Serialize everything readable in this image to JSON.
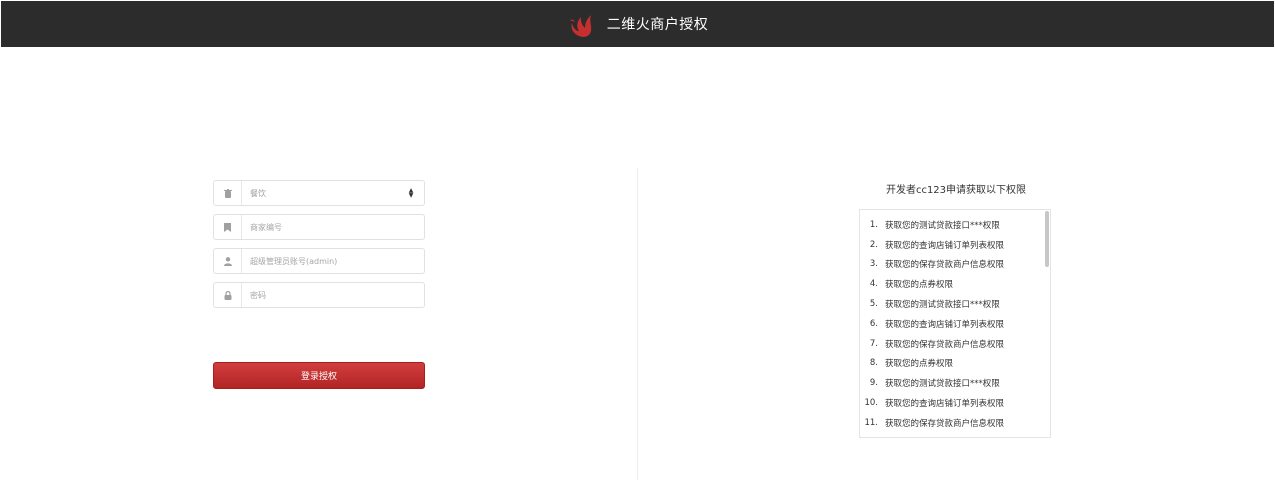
{
  "header": {
    "title": "二维火商户授权",
    "logo_icon": "flame-icon"
  },
  "form": {
    "category": {
      "value": "餐饮",
      "icon": "trash-icon"
    },
    "merchant_id": {
      "placeholder": "商家编号",
      "icon": "bookmark-icon"
    },
    "admin_account": {
      "placeholder": "超级管理员账号(admin)",
      "icon": "user-icon"
    },
    "password": {
      "placeholder": "密码",
      "icon": "lock-icon"
    },
    "submit_label": "登录授权"
  },
  "permissions": {
    "title": "开发者cc123申请获取以下权限",
    "items": [
      {
        "num": "1.",
        "text": "获取您的测试贷款接口***权限"
      },
      {
        "num": "2.",
        "text": "获取您的查询店铺订单列表权限"
      },
      {
        "num": "3.",
        "text": "获取您的保存贷款商户信息权限"
      },
      {
        "num": "4.",
        "text": "获取您的点券权限"
      },
      {
        "num": "5.",
        "text": "获取您的测试贷款接口***权限"
      },
      {
        "num": "6.",
        "text": "获取您的查询店铺订单列表权限"
      },
      {
        "num": "7.",
        "text": "获取您的保存贷款商户信息权限"
      },
      {
        "num": "8.",
        "text": "获取您的点券权限"
      },
      {
        "num": "9.",
        "text": "获取您的测试贷款接口***权限"
      },
      {
        "num": "10.",
        "text": "获取您的查询店铺订单列表权限"
      },
      {
        "num": "11.",
        "text": "获取您的保存贷款商户信息权限"
      }
    ]
  },
  "colors": {
    "header_bg": "#2c2c2c",
    "accent": "#c62f2f"
  }
}
